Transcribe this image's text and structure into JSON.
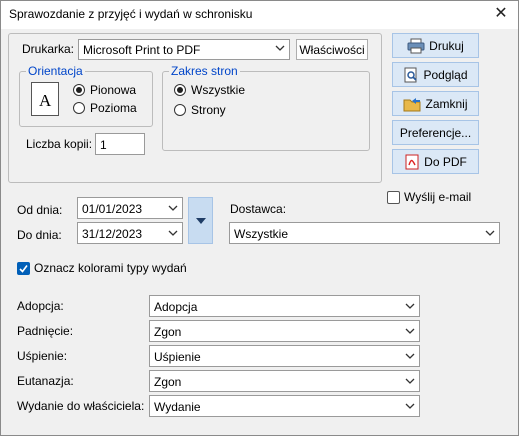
{
  "window": {
    "title": "Sprawozdanie z przyjęć i wydań w schronisku",
    "close_glyph": "✕"
  },
  "printer": {
    "label": "Drukarka:",
    "selected": "Microsoft Print to PDF",
    "properties_label": "Właściwości",
    "copies_label": "Liczba kopii:",
    "copies_value": "1"
  },
  "orientation": {
    "legend": "Orientacja",
    "portrait": "Pionowa",
    "landscape": "Pozioma",
    "selected": "portrait",
    "icon_letter": "A"
  },
  "page_range": {
    "legend": "Zakres stron",
    "all": "Wszystkie",
    "pages": "Strony",
    "selected": "all"
  },
  "actions": {
    "print": "Drukuj",
    "preview": "Podgląd",
    "close": "Zamknij",
    "preferences": "Preferencje...",
    "pdf": "Do PDF",
    "email": "Wyślij e-mail",
    "email_checked": false
  },
  "dates": {
    "from_label": "Od dnia:",
    "from_value": "01/01/2023",
    "to_label": "Do dnia:",
    "to_value": "31/12/2023"
  },
  "supplier": {
    "label": "Dostawca:",
    "selected": "Wszystkie"
  },
  "color_types": {
    "label": "Oznacz kolorami typy wydań",
    "checked": true
  },
  "mappings": [
    {
      "label": "Adopcja:",
      "value": "Adopcja"
    },
    {
      "label": "Padnięcie:",
      "value": "Zgon"
    },
    {
      "label": "Uśpienie:",
      "value": "Uśpienie"
    },
    {
      "label": "Eutanazja:",
      "value": "Zgon"
    },
    {
      "label": "Wydanie do właściciela:",
      "value": "Wydanie"
    }
  ],
  "colors": {
    "accent": "#005fb8",
    "legend": "#0045c9",
    "button_bg": "#dbe8f6",
    "button_border": "#a7c4e6"
  }
}
